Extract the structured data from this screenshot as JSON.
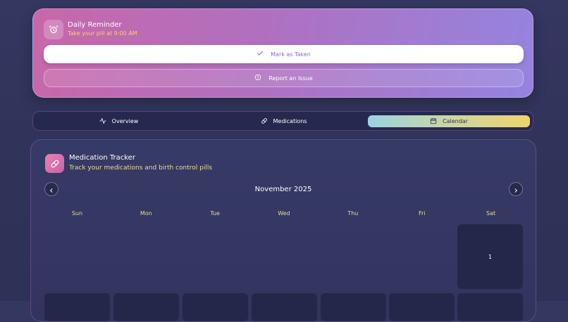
{
  "reminder": {
    "title": "Daily Reminder",
    "subtitle": "Take your pill at 9:00 AM",
    "icon": "alarm-clock-icon",
    "mark_taken_label": "Mark as Taken",
    "report_issue_label": "Report an Issue"
  },
  "tabs": [
    {
      "label": "Overview",
      "icon": "activity-icon",
      "active": false
    },
    {
      "label": "Medications",
      "icon": "pill-icon",
      "active": false
    },
    {
      "label": "Calendar",
      "icon": "calendar-icon",
      "active": true
    }
  ],
  "tracker": {
    "title": "Medication Tracker",
    "subtitle": "Track your medications and birth control pills",
    "icon": "pill-icon",
    "month_label": "November 2025",
    "weekdays": [
      "Sun",
      "Mon",
      "Tue",
      "Wed",
      "Thu",
      "Fri",
      "Sat"
    ],
    "first_day": "1"
  },
  "colors": {
    "accent_yellow": "#f2dc8a",
    "brand_purple": "#b070bf",
    "background": "#2f3358"
  }
}
